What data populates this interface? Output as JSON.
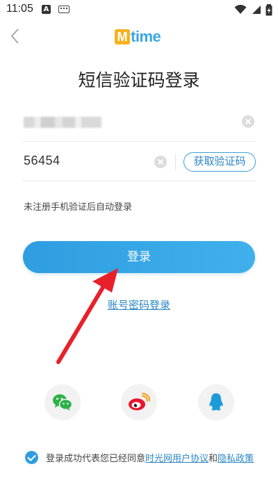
{
  "status_bar": {
    "time": "11:05",
    "a_badge": "A"
  },
  "header": {
    "logo_m": "M",
    "logo_text": "time"
  },
  "title": "短信验证码登录",
  "phone_field": {
    "value": ""
  },
  "code_field": {
    "value": "56454",
    "get_code_label": "获取验证码"
  },
  "hint": "未注册手机验证后自动登录",
  "login_button": "登录",
  "password_login_link": "账号密码登录",
  "social": {
    "icons": [
      "wechat-icon",
      "weibo-icon",
      "qq-icon"
    ]
  },
  "agreement": {
    "prefix": "登录成功代表您已经同意",
    "link1": "时光网用户协议",
    "joiner": "和",
    "link2": "隐私政策",
    "checked": true
  },
  "colors": {
    "accent": "#2f9de0",
    "link": "#2a86c4",
    "logo_yellow": "#f5b31f",
    "annotation_red": "#e8202a"
  }
}
